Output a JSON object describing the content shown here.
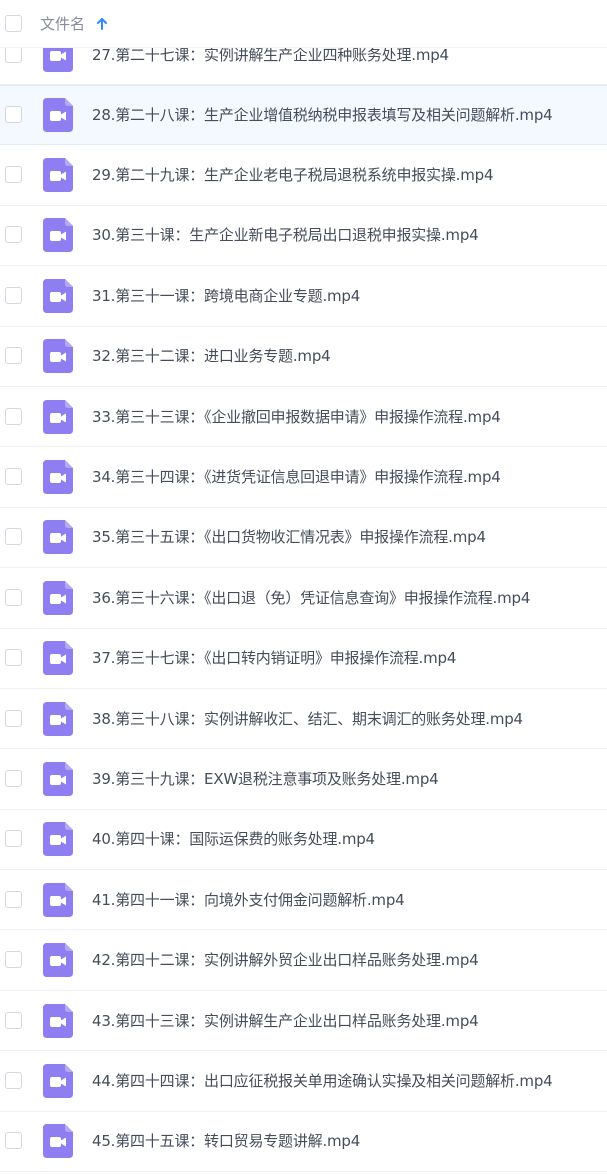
{
  "header": {
    "column_label": "文件名",
    "sort_icon": "arrow-up-icon"
  },
  "file_icon": "video-file-icon",
  "colors": {
    "accent": "#2f8cff",
    "file_icon": "#8e7ef1",
    "selected_row": "#f4f8ff"
  },
  "files": [
    {
      "name": "27.第二十七课：实例讲解生产企业四种账务处理.mp4",
      "selected": false
    },
    {
      "name": "28.第二十八课：生产企业增值税纳税申报表填写及相关问题解析.mp4",
      "selected": true
    },
    {
      "name": "29.第二十九课：生产企业老电子税局退税系统申报实操.mp4",
      "selected": false
    },
    {
      "name": "30.第三十课：生产企业新电子税局出口退税申报实操.mp4",
      "selected": false
    },
    {
      "name": "31.第三十一课：跨境电商企业专题.mp4",
      "selected": false
    },
    {
      "name": "32.第三十二课：进口业务专题.mp4",
      "selected": false
    },
    {
      "name": "33.第三十三课：《企业撤回申报数据申请》申报操作流程.mp4",
      "selected": false
    },
    {
      "name": "34.第三十四课：《进货凭证信息回退申请》申报操作流程.mp4",
      "selected": false
    },
    {
      "name": "35.第三十五课：《出口货物收汇情况表》申报操作流程.mp4",
      "selected": false
    },
    {
      "name": "36.第三十六课：《出口退（免）凭证信息查询》申报操作流程.mp4",
      "selected": false
    },
    {
      "name": "37.第三十七课：《出口转内销证明》申报操作流程.mp4",
      "selected": false
    },
    {
      "name": "38.第三十八课：实例讲解收汇、结汇、期末调汇的账务处理.mp4",
      "selected": false
    },
    {
      "name": "39.第三十九课：EXW退税注意事项及账务处理.mp4",
      "selected": false
    },
    {
      "name": "40.第四十课：国际运保费的账务处理.mp4",
      "selected": false
    },
    {
      "name": "41.第四十一课：向境外支付佣金问题解析.mp4",
      "selected": false
    },
    {
      "name": "42.第四十二课：实例讲解外贸企业出口样品账务处理.mp4",
      "selected": false
    },
    {
      "name": "43.第四十三课：实例讲解生产企业出口样品账务处理.mp4",
      "selected": false
    },
    {
      "name": "44.第四十四课：出口应征税报关单用途确认实操及相关问题解析.mp4",
      "selected": false
    },
    {
      "name": "45.第四十五课：转口贸易专题讲解.mp4",
      "selected": false
    }
  ]
}
